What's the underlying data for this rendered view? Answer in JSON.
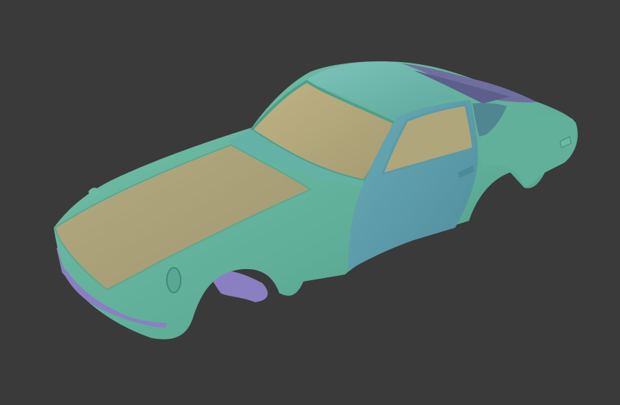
{
  "viewport": {
    "background_color": "#3a3a3a"
  },
  "model": {
    "colors": {
      "body_green": "#5fae98",
      "body_green_dark": "#4a9682",
      "roof_teal": "#6fb7ad",
      "door_blue": "#5f9fac",
      "panel_tan": "#a9a27a",
      "panel_tan_light": "#b7ad84",
      "rear_window_purple": "#6f6f9e",
      "chassis_purple": "#8a7fc0",
      "side_window_dark": "#4f8690"
    }
  }
}
